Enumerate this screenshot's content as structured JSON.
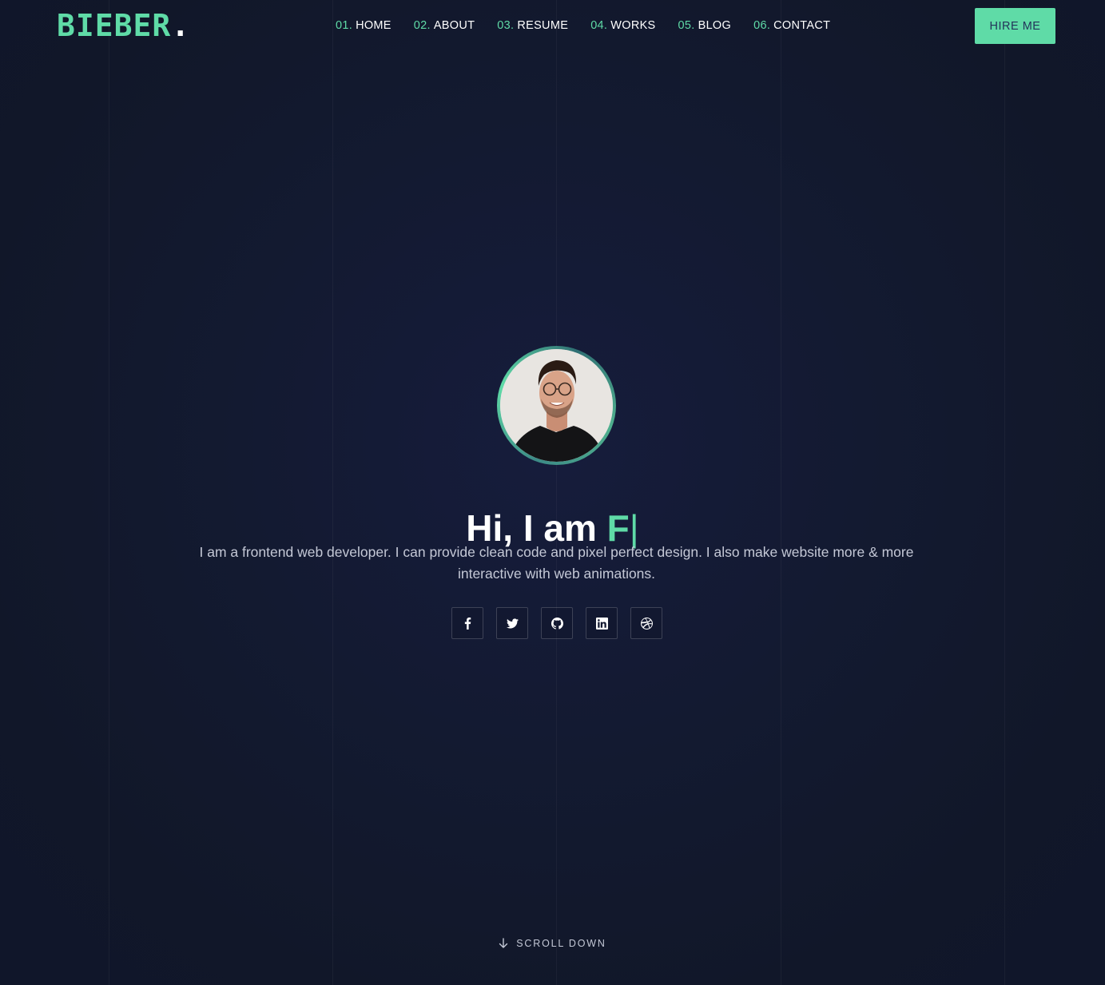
{
  "header": {
    "logo_text": "BIEBER",
    "logo_dot": ".",
    "nav": [
      {
        "num": "01.",
        "label": "HOME"
      },
      {
        "num": "02.",
        "label": "ABOUT"
      },
      {
        "num": "03.",
        "label": "RESUME"
      },
      {
        "num": "04.",
        "label": "WORKS"
      },
      {
        "num": "05.",
        "label": "BLOG"
      },
      {
        "num": "06.",
        "label": "CONTACT"
      }
    ],
    "hire_label": "HIRE ME"
  },
  "hero": {
    "greeting": "Hi, I am ",
    "typed_text": "F",
    "cursor": "|",
    "description": "I am a frontend web developer. I can provide clean code and pixel perfect design. I also make website more & more interactive with web animations."
  },
  "socials": [
    {
      "icon": "facebook-icon"
    },
    {
      "icon": "twitter-icon"
    },
    {
      "icon": "github-icon"
    },
    {
      "icon": "linkedin-icon"
    },
    {
      "icon": "dribbble-icon"
    }
  ],
  "scroll_down": {
    "label": "SCROLL DOWN",
    "icon": "arrow-down-icon"
  },
  "colors": {
    "accent": "#5fdba7",
    "background": "#131a31",
    "text": "#ffffff",
    "muted_text": "#c4c8d6"
  }
}
